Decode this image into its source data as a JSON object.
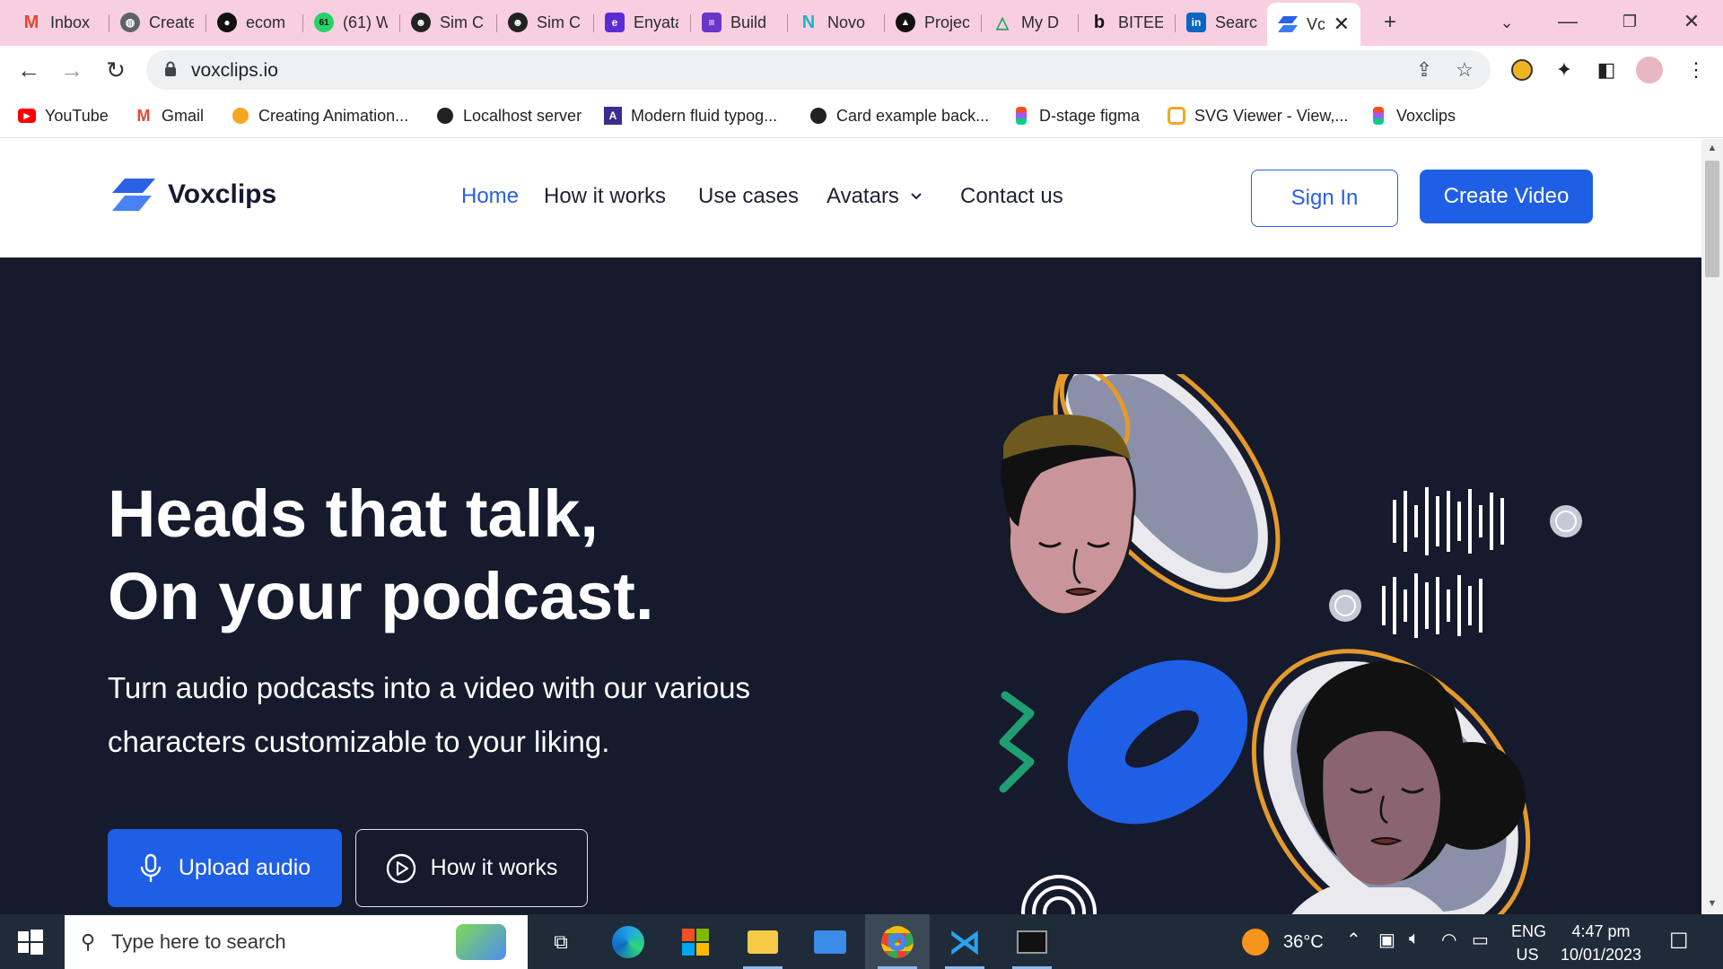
{
  "browser": {
    "tabs": [
      {
        "label": "Inbox",
        "icon": "gmail-icon",
        "color": "#ea4335"
      },
      {
        "label": "Create",
        "icon": "globe-icon",
        "color": "#5f6368"
      },
      {
        "label": "ecom",
        "icon": "github-icon",
        "color": "#111111"
      },
      {
        "label": "(61) W",
        "icon": "whatsapp-icon",
        "color": "#25d366"
      },
      {
        "label": "Sim Cl",
        "icon": "alien-icon",
        "color": "#222222"
      },
      {
        "label": "Sim Cl",
        "icon": "alien-icon",
        "color": "#222222"
      },
      {
        "label": "Enyata",
        "icon": "enyata-icon",
        "color": "#5b2bd6"
      },
      {
        "label": "Build",
        "icon": "form-icon",
        "color": "#6a35c9"
      },
      {
        "label": "Novo",
        "icon": "novo-icon",
        "color": "#1bb5c8"
      },
      {
        "label": "Projec",
        "icon": "triangle-icon",
        "color": "#111111"
      },
      {
        "label": "My D",
        "icon": "drive-icon",
        "color": "#1fa463"
      },
      {
        "label": "BITEE",
        "icon": "bitee-icon",
        "color": "#111111"
      },
      {
        "label": "Searc",
        "icon": "linkedin-icon",
        "color": "#0a66c2"
      },
      {
        "label": "Vc",
        "icon": "voxclips-icon",
        "color": "#2a60e4"
      }
    ],
    "address": "voxclips.io",
    "bookmarks": [
      {
        "label": "YouTube",
        "icon": "youtube-icon",
        "color": "#ff0000"
      },
      {
        "label": "Gmail",
        "icon": "gmail-icon",
        "color": "#ea4335"
      },
      {
        "label": "Creating Animation...",
        "icon": "animation-icon",
        "color": "#f5a623"
      },
      {
        "label": "Localhost server",
        "icon": "globe-icon",
        "color": "#222222"
      },
      {
        "label": "Modern fluid typog...",
        "icon": "typography-icon",
        "color": "#3c2c8c"
      },
      {
        "label": "Card example back...",
        "icon": "globe-icon",
        "color": "#222222"
      },
      {
        "label": "D-stage figma",
        "icon": "figma-icon",
        "color": "#f24e1e"
      },
      {
        "label": "SVG Viewer - View,...",
        "icon": "svg-viewer-icon",
        "color": "#f5a623"
      },
      {
        "label": "Voxclips",
        "icon": "figma-icon",
        "color": "#f24e1e"
      }
    ]
  },
  "site": {
    "logo_text": "Voxclips",
    "nav": [
      {
        "label": "Home",
        "active": true
      },
      {
        "label": "How it works"
      },
      {
        "label": "Use cases"
      },
      {
        "label": "Avatars"
      },
      {
        "label": "Contact us"
      }
    ],
    "signin_label": "Sign In",
    "create_label": "Create Video",
    "brand_color": "#1f5fe6",
    "hero_bg": "#151a2c"
  },
  "hero": {
    "title_line1": "Heads that talk,",
    "title_line2": "On your podcast.",
    "subtitle": "Turn audio podcasts into a video with our various characters customizable to your liking.",
    "upload_label": "Upload audio",
    "how_label": "How it works"
  },
  "taskbar": {
    "search_placeholder": "Type here to search",
    "weather": "36°C",
    "lang_line1": "ENG",
    "lang_line2": "US",
    "time": "4:47 pm",
    "date": "10/01/2023"
  }
}
